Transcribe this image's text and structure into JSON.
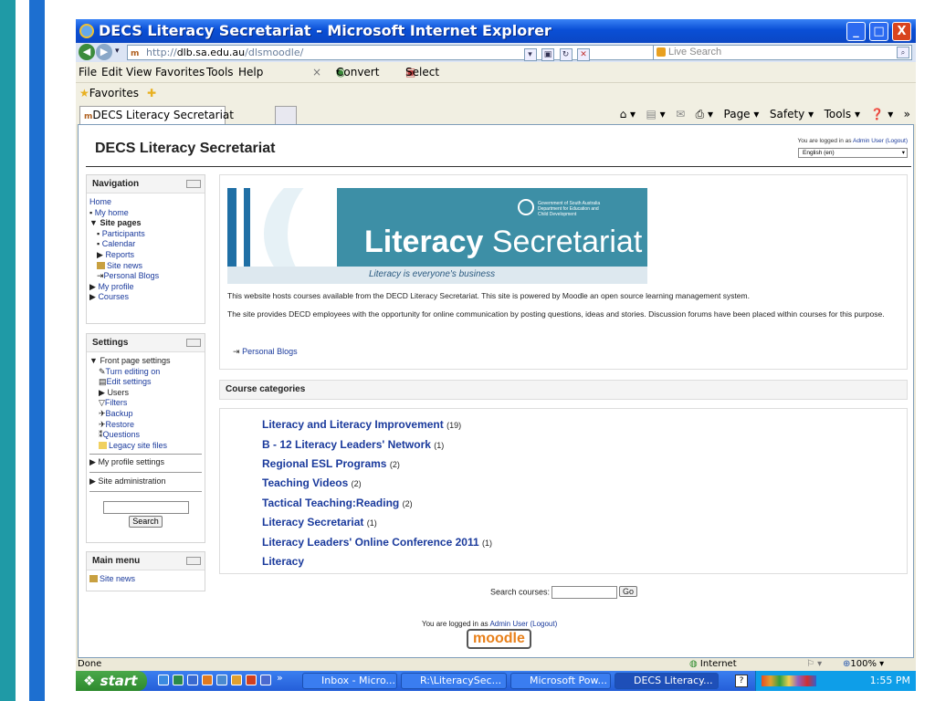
{
  "window": {
    "title": "DECS Literacy Secretariat - Microsoft Internet Explorer",
    "minimize": "_",
    "maximize": "□",
    "close": "X"
  },
  "address": {
    "url_prefix": "http://",
    "url_domain": "dlb.sa.edu.au",
    "url_path": "/dlsmoodle/",
    "search_placeholder": "Live Search"
  },
  "menu": [
    "File",
    "Edit",
    "View",
    "Favorites",
    "Tools",
    "Help"
  ],
  "menu_extra": {
    "close": "×",
    "convert": "Convert",
    "select": "Select"
  },
  "favorites_label": "Favorites",
  "tab": {
    "label": "DECS Literacy Secretariat"
  },
  "commandbar": {
    "page": "Page",
    "safety": "Safety",
    "tools": "Tools"
  },
  "site": {
    "title": "DECS Literacy Secretariat",
    "logged_prefix": "You are logged in as",
    "user": "Admin User",
    "logout": "(Logout)",
    "language": "English (en)"
  },
  "navigation": {
    "title": "Navigation",
    "home": "Home",
    "my_home": "My home",
    "site_pages": "Site pages",
    "participants": "Participants",
    "calendar": "Calendar",
    "reports": "Reports",
    "site_news": "Site news",
    "personal_blogs": "Personal Blogs",
    "my_profile": "My profile",
    "courses": "Courses"
  },
  "settings": {
    "title": "Settings",
    "front_page": "Front page settings",
    "items": [
      "Turn editing on",
      "Edit settings",
      "Users",
      "Filters",
      "Backup",
      "Restore",
      "Questions",
      "Legacy site files"
    ],
    "my_profile": "My profile settings",
    "site_admin": "Site administration",
    "search_button": "Search"
  },
  "main_menu": {
    "title": "Main menu",
    "site_news": "Site news"
  },
  "banner": {
    "word_bold": "Literacy",
    "word_light": "Secretariat",
    "tagline": "Literacy is everyone's business",
    "govt1": "Government of South Australia",
    "govt2": "Department for Education and",
    "govt3": "Child Development"
  },
  "intro": {
    "p1": "This website hosts courses available from the DECD Literacy Secretariat. This site is powered by Moodle an open source learning management system.",
    "p2": "The site provides DECD employees with the opportunity for online communication by posting questions, ideas and stories. Discussion forums have been placed within courses for this purpose.",
    "blog_link": "Personal Blogs"
  },
  "categories": {
    "title": "Course categories",
    "items": [
      {
        "name": "Literacy and Literacy Improvement",
        "count": "(19)"
      },
      {
        "name": "B - 12 Literacy Leaders' Network",
        "count": "(1)"
      },
      {
        "name": "Regional ESL Programs",
        "count": "(2)"
      },
      {
        "name": "Teaching Videos",
        "count": "(2)"
      },
      {
        "name": "Tactical Teaching:Reading",
        "count": "(2)"
      },
      {
        "name": "Literacy Secretariat",
        "count": "(1)"
      },
      {
        "name": "Literacy Leaders' Online Conference 2011",
        "count": "(1)"
      },
      {
        "name": "Literacy",
        "count": ""
      }
    ]
  },
  "search_courses": {
    "label": "Search courses:",
    "go": "Go"
  },
  "footer": {
    "logged": "You are logged in as",
    "user": "Admin User",
    "logout": "(Logout)",
    "logo": "moodle"
  },
  "status": {
    "left": "Done",
    "zone": "Internet",
    "zoom": "100%"
  },
  "taskbar": {
    "start": "start",
    "items": [
      "Inbox - Micro...",
      "R:\\LiteracySec...",
      "Microsoft Pow...",
      "DECS Literacy..."
    ],
    "time": "1:55 PM"
  }
}
